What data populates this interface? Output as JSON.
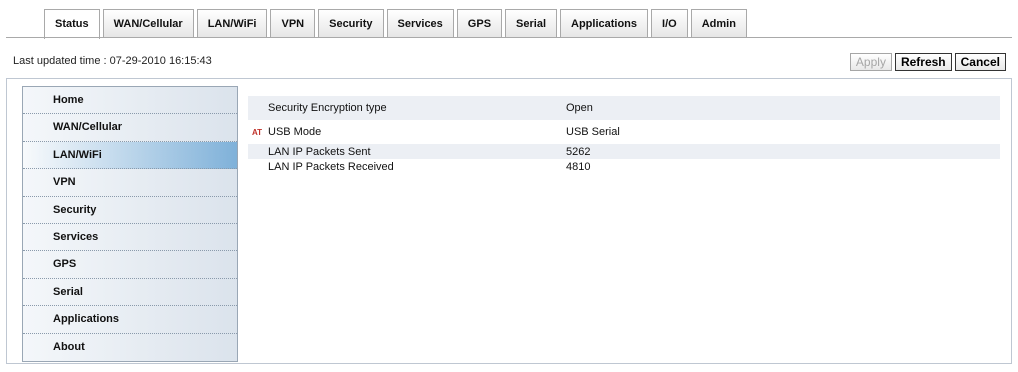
{
  "tabs": [
    "Status",
    "WAN/Cellular",
    "LAN/WiFi",
    "VPN",
    "Security",
    "Services",
    "GPS",
    "Serial",
    "Applications",
    "I/O",
    "Admin"
  ],
  "last_updated": {
    "label": "Last updated time : ",
    "value": "07-29-2010 16:15:43"
  },
  "buttons": {
    "apply": "Apply",
    "refresh": "Refresh",
    "cancel": "Cancel"
  },
  "sidebar": [
    "Home",
    "WAN/Cellular",
    "LAN/WiFi",
    "VPN",
    "Security",
    "Services",
    "GPS",
    "Serial",
    "Applications",
    "About"
  ],
  "rows": [
    {
      "label": "Security Encryption type",
      "value": "Open",
      "marker": ""
    },
    {
      "label": "USB Mode",
      "value": "USB Serial",
      "marker": "AT"
    },
    {
      "label": "LAN IP Packets Sent",
      "value": "5262",
      "marker": ""
    },
    {
      "label": "LAN IP Packets Received",
      "value": "4810",
      "marker": ""
    }
  ]
}
